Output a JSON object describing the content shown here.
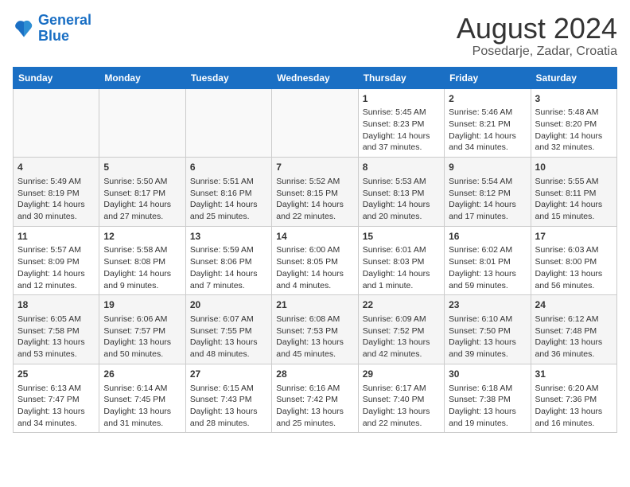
{
  "header": {
    "logo_line1": "General",
    "logo_line2": "Blue",
    "title": "August 2024",
    "subtitle": "Posedarje, Zadar, Croatia"
  },
  "days_of_week": [
    "Sunday",
    "Monday",
    "Tuesday",
    "Wednesday",
    "Thursday",
    "Friday",
    "Saturday"
  ],
  "weeks": [
    [
      {
        "day": "",
        "info": ""
      },
      {
        "day": "",
        "info": ""
      },
      {
        "day": "",
        "info": ""
      },
      {
        "day": "",
        "info": ""
      },
      {
        "day": "1",
        "info": "Sunrise: 5:45 AM\nSunset: 8:23 PM\nDaylight: 14 hours and 37 minutes."
      },
      {
        "day": "2",
        "info": "Sunrise: 5:46 AM\nSunset: 8:21 PM\nDaylight: 14 hours and 34 minutes."
      },
      {
        "day": "3",
        "info": "Sunrise: 5:48 AM\nSunset: 8:20 PM\nDaylight: 14 hours and 32 minutes."
      }
    ],
    [
      {
        "day": "4",
        "info": "Sunrise: 5:49 AM\nSunset: 8:19 PM\nDaylight: 14 hours and 30 minutes."
      },
      {
        "day": "5",
        "info": "Sunrise: 5:50 AM\nSunset: 8:17 PM\nDaylight: 14 hours and 27 minutes."
      },
      {
        "day": "6",
        "info": "Sunrise: 5:51 AM\nSunset: 8:16 PM\nDaylight: 14 hours and 25 minutes."
      },
      {
        "day": "7",
        "info": "Sunrise: 5:52 AM\nSunset: 8:15 PM\nDaylight: 14 hours and 22 minutes."
      },
      {
        "day": "8",
        "info": "Sunrise: 5:53 AM\nSunset: 8:13 PM\nDaylight: 14 hours and 20 minutes."
      },
      {
        "day": "9",
        "info": "Sunrise: 5:54 AM\nSunset: 8:12 PM\nDaylight: 14 hours and 17 minutes."
      },
      {
        "day": "10",
        "info": "Sunrise: 5:55 AM\nSunset: 8:11 PM\nDaylight: 14 hours and 15 minutes."
      }
    ],
    [
      {
        "day": "11",
        "info": "Sunrise: 5:57 AM\nSunset: 8:09 PM\nDaylight: 14 hours and 12 minutes."
      },
      {
        "day": "12",
        "info": "Sunrise: 5:58 AM\nSunset: 8:08 PM\nDaylight: 14 hours and 9 minutes."
      },
      {
        "day": "13",
        "info": "Sunrise: 5:59 AM\nSunset: 8:06 PM\nDaylight: 14 hours and 7 minutes."
      },
      {
        "day": "14",
        "info": "Sunrise: 6:00 AM\nSunset: 8:05 PM\nDaylight: 14 hours and 4 minutes."
      },
      {
        "day": "15",
        "info": "Sunrise: 6:01 AM\nSunset: 8:03 PM\nDaylight: 14 hours and 1 minute."
      },
      {
        "day": "16",
        "info": "Sunrise: 6:02 AM\nSunset: 8:01 PM\nDaylight: 13 hours and 59 minutes."
      },
      {
        "day": "17",
        "info": "Sunrise: 6:03 AM\nSunset: 8:00 PM\nDaylight: 13 hours and 56 minutes."
      }
    ],
    [
      {
        "day": "18",
        "info": "Sunrise: 6:05 AM\nSunset: 7:58 PM\nDaylight: 13 hours and 53 minutes."
      },
      {
        "day": "19",
        "info": "Sunrise: 6:06 AM\nSunset: 7:57 PM\nDaylight: 13 hours and 50 minutes."
      },
      {
        "day": "20",
        "info": "Sunrise: 6:07 AM\nSunset: 7:55 PM\nDaylight: 13 hours and 48 minutes."
      },
      {
        "day": "21",
        "info": "Sunrise: 6:08 AM\nSunset: 7:53 PM\nDaylight: 13 hours and 45 minutes."
      },
      {
        "day": "22",
        "info": "Sunrise: 6:09 AM\nSunset: 7:52 PM\nDaylight: 13 hours and 42 minutes."
      },
      {
        "day": "23",
        "info": "Sunrise: 6:10 AM\nSunset: 7:50 PM\nDaylight: 13 hours and 39 minutes."
      },
      {
        "day": "24",
        "info": "Sunrise: 6:12 AM\nSunset: 7:48 PM\nDaylight: 13 hours and 36 minutes."
      }
    ],
    [
      {
        "day": "25",
        "info": "Sunrise: 6:13 AM\nSunset: 7:47 PM\nDaylight: 13 hours and 34 minutes."
      },
      {
        "day": "26",
        "info": "Sunrise: 6:14 AM\nSunset: 7:45 PM\nDaylight: 13 hours and 31 minutes."
      },
      {
        "day": "27",
        "info": "Sunrise: 6:15 AM\nSunset: 7:43 PM\nDaylight: 13 hours and 28 minutes."
      },
      {
        "day": "28",
        "info": "Sunrise: 6:16 AM\nSunset: 7:42 PM\nDaylight: 13 hours and 25 minutes."
      },
      {
        "day": "29",
        "info": "Sunrise: 6:17 AM\nSunset: 7:40 PM\nDaylight: 13 hours and 22 minutes."
      },
      {
        "day": "30",
        "info": "Sunrise: 6:18 AM\nSunset: 7:38 PM\nDaylight: 13 hours and 19 minutes."
      },
      {
        "day": "31",
        "info": "Sunrise: 6:20 AM\nSunset: 7:36 PM\nDaylight: 13 hours and 16 minutes."
      }
    ]
  ]
}
